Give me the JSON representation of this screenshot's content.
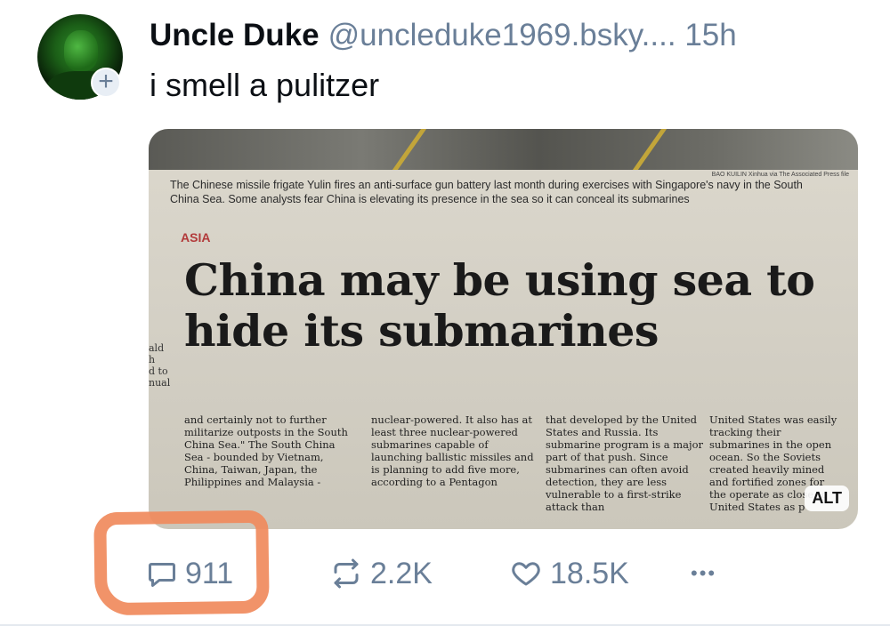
{
  "post": {
    "author_name": "Uncle Duke",
    "handle": "@uncleduke1969.bsky....",
    "timestamp": "15h",
    "text": "i smell a pulitzer"
  },
  "follow_badge": "+",
  "media": {
    "caption": "The Chinese missile frigate Yulin fires an anti-surface gun battery last month during exercises with Singapore's navy in the South China Sea. Some analysts fear China is elevating its presence in the sea so it can conceal its submarines",
    "photo_credit": "BAO KUILIN Xinhua via The Associated Press file",
    "section": "ASIA",
    "headline": "China may be using sea to hide its submarines",
    "margin_text": "ald\nh\nd to\nnual",
    "columns": [
      "and certainly not to further militarize outposts in the South China Sea.\" The South China Sea - bounded by Vietnam, China, Taiwan, Japan, the Philippines and Malaysia -",
      "nuclear-powered. It also has at least three nuclear-powered submarines capable of launching ballistic missiles and is planning to add five more, according to a Pentagon",
      "that developed by the United States and Russia. Its submarine program is a major part of that push. Since submarines can often avoid detection, they are less vulnerable to a first-strike attack than",
      "United States was easily tracking their submarines in the open ocean. So the Soviets created heavily mined and fortified zones for the operate as close to United States as p"
    ],
    "alt_badge": "ALT"
  },
  "actions": {
    "replies": "911",
    "reposts": "2.2K",
    "likes": "18.5K",
    "more": "•••"
  },
  "icons": {
    "reply": "speech-bubble-icon",
    "repost": "repost-arrows-icon",
    "like": "heart-icon",
    "more": "ellipsis-icon"
  },
  "colors": {
    "muted": "#6a7f98",
    "highlight": "#f08a5c"
  }
}
